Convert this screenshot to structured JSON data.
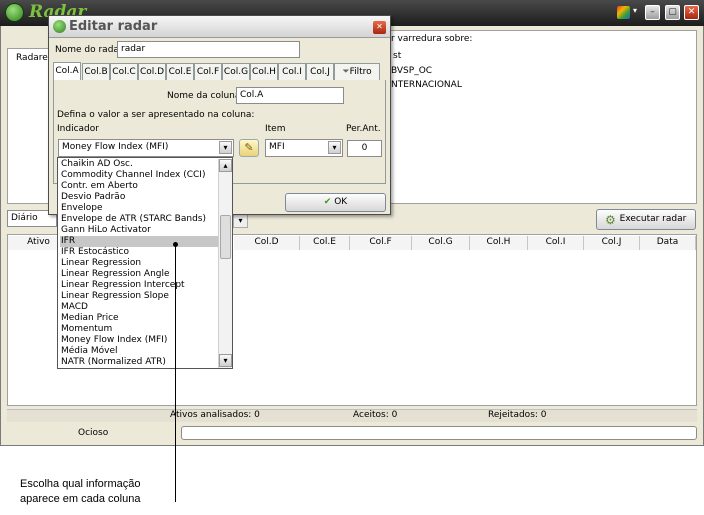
{
  "app": {
    "title": "Radar"
  },
  "main": {
    "radares_label": "Radares",
    "varredura_label": "r varredura sobre:",
    "varredura_items": [
      "st",
      "BVSP_OC",
      "NTERNACIONAL"
    ],
    "period_select": "Diário",
    "executar_label": "Executar radar",
    "columns": [
      "Ativo",
      "Col.D",
      "Col.E",
      "Col.F",
      "Col.G",
      "Col.H",
      "Col.I",
      "Col.J",
      "Data"
    ],
    "status": {
      "analisados": "Ativos analisados: 0",
      "aceitos": "Aceitos: 0",
      "rejeitados": "Rejeitados: 0"
    },
    "state": "Ocioso"
  },
  "dialog": {
    "title": "Editar radar",
    "nome_radar_label": "Nome do radar",
    "nome_radar_value": "radar",
    "tabs": [
      "Col.A",
      "Col.B",
      "Col.C",
      "Col.D",
      "Col.E",
      "Col.F",
      "Col.G",
      "Col.H",
      "Col.I",
      "Col.J",
      "Filtro"
    ],
    "nome_coluna_label": "Nome da coluna",
    "nome_coluna_value": "Col.A",
    "defina_label": "Defina o valor a ser apresentado na coluna:",
    "indicador_label": "Indicador",
    "item_label": "Item",
    "per_ant_label": "Per.Ant.",
    "indicador_value": "Money Flow Index (MFI)",
    "item_value": "MFI",
    "per_ant_value": "0",
    "ok_label": "OK"
  },
  "dropdown": {
    "items": [
      "Chaikin AD Osc.",
      "Commodity Channel Index (CCI)",
      "Contr. em Aberto",
      "Desvio Padrão",
      "Envelope",
      "Envelope de ATR (STARC Bands)",
      "Gann HiLo Activator",
      "IFR",
      "IFR Estocástico",
      "Linear Regression",
      "Linear Regression Angle",
      "Linear Regression Intercept",
      "Linear Regression Slope",
      "MACD",
      "Median Price",
      "Momentum",
      "Money Flow Index (MFI)",
      "Média Móvel",
      "NATR (Normalized ATR)"
    ],
    "selected_index": 7
  },
  "callout": {
    "line1": "Escolha qual informação",
    "line2": "aparece em cada coluna"
  }
}
